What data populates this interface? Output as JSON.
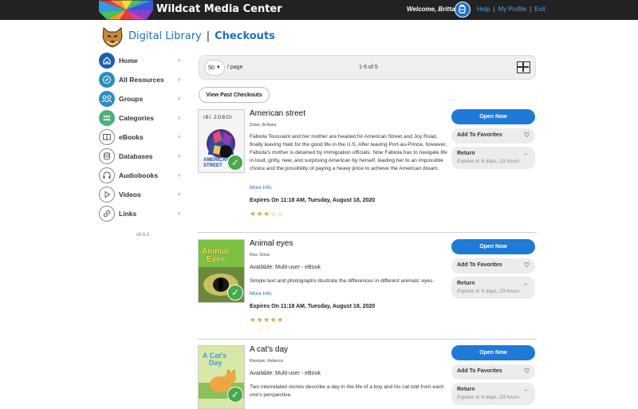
{
  "topbar": {
    "app_title": "Wildcat Media Center",
    "welcome": "Welcome, Britta!",
    "links": [
      "Help",
      "My Profile",
      "Exit"
    ]
  },
  "header": {
    "section": "Digital Library",
    "page": "Checkouts"
  },
  "sidebar": {
    "items": [
      {
        "label": "Home",
        "icon": "home-icon"
      },
      {
        "label": "All Resources",
        "icon": "compass-icon"
      },
      {
        "label": "Groups",
        "icon": "people-icon"
      },
      {
        "label": "Categories",
        "icon": "grid-dots-icon"
      },
      {
        "label": "eBooks",
        "icon": "book-icon"
      },
      {
        "label": "Databases",
        "icon": "database-icon"
      },
      {
        "label": "Audiobooks",
        "icon": "headphones-icon"
      },
      {
        "label": "Videos",
        "icon": "play-icon"
      },
      {
        "label": "Links",
        "icon": "link-icon"
      }
    ],
    "version": "v5.6.0"
  },
  "toolbar": {
    "per_page_value": "50",
    "per_page_label": "/ page",
    "count": "1-5 of 5"
  },
  "past_checkouts_button": "View Past Checkouts",
  "items": [
    {
      "title": "American street",
      "author": "Zoboi, Ibi Aanu",
      "availability": "",
      "description": "Fabiola Toussaint and her mother are headed for American Street and Joy Road, finally leaving Haiti for the good life in the U.S. After leaving Port-au-Prince, however, Fabiola's mother is detained by immigration officials. Now Fabiola has to navigate life in loud, gritty, new, and surprising American by herself, leading her to an impossible choice and the possibility of paying a heavy price to achieve the American dream.",
      "more_info": "More Info",
      "expires": "Expires On 11:18 AM, Tuesday, August 18, 2020",
      "rating": 3,
      "stars": "★★★☆☆",
      "cover_lines": [
        "IBI ZOBOI",
        "AMERICAN",
        "STREET"
      ]
    },
    {
      "title": "Animal eyes",
      "author": "Rice, Dona",
      "availability": "Available: Multi-user - eBook",
      "description": "Simple text and photographs illustrate the differences in different animals' eyes.",
      "more_info": "More Info",
      "expires": "Expires On 11:18 AM, Tuesday, August 18, 2020",
      "rating": 5,
      "stars": "★★★★★",
      "cover_lines": [
        "Animal",
        "Eyes"
      ]
    },
    {
      "title": "A cat's day",
      "author": "Rissman, Rebecca",
      "availability": "Available: Multi-user - eBook",
      "description": "Two interrelated stories describe a day in the life of a boy and his cat told from each one's perspective.",
      "more_info": "",
      "expires": "",
      "rating": 0,
      "stars": "",
      "cover_lines": [
        "A Cat's",
        "Day"
      ]
    }
  ],
  "actions": {
    "open": "Open Now",
    "favorite": "Add To Favorites",
    "return": "Return",
    "return_sub": "Expires in 6 days, 23 hours"
  },
  "colors": {
    "accent": "#1e7ad6",
    "topbar": "#222222",
    "star": "#e8a33a",
    "check": "#47a84c"
  }
}
